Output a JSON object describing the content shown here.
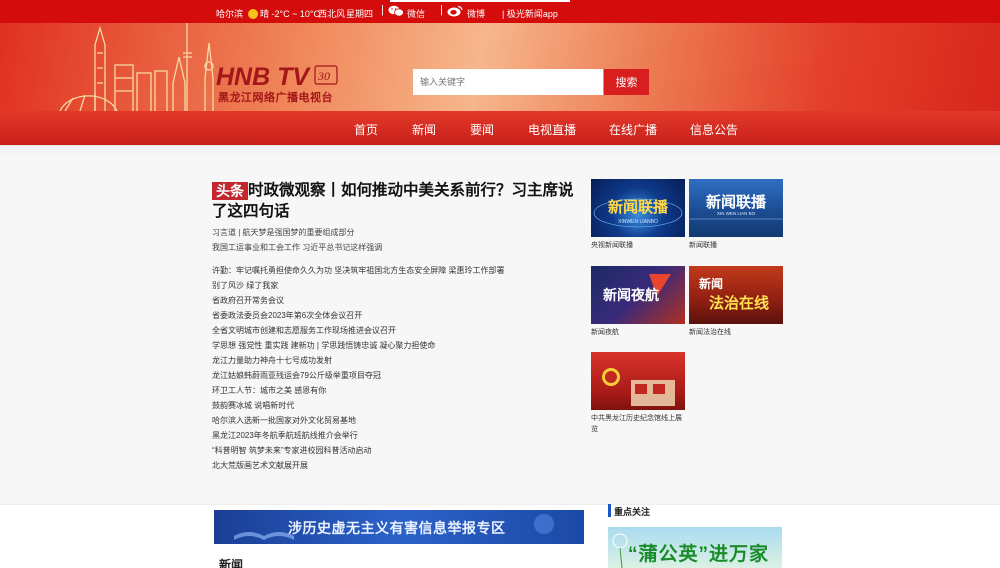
{
  "topbar": {
    "city": "哈尔滨",
    "weather": "晴 -2°C ~ 10°C",
    "wind": "西北风",
    "weekday": "星期四",
    "wechat_label": "微信",
    "weibo_label": "微博",
    "app_label": "| 极光新闻app"
  },
  "header": {
    "logo_main": "HNB TV",
    "logo_sub": "黑龙江网络广播电视台",
    "search_placeholder": "输入关键字",
    "search_button": "搜索"
  },
  "nav": {
    "items": [
      {
        "label": "首页"
      },
      {
        "label": "新闻"
      },
      {
        "label": "要闻"
      },
      {
        "label": "电视直播"
      },
      {
        "label": "在线广播"
      },
      {
        "label": "信息公告"
      }
    ]
  },
  "headline": {
    "tag": "头条",
    "title": "时政微观察丨如何推动中美关系前行？习主席说了这四句话"
  },
  "sub_links": [
    "习言道 | 航天梦是强国梦的重要组成部分",
    "我国工运事业和工会工作 习近平总书记这样强调"
  ],
  "news_list": [
    "许勤：牢记嘱托勇担使命久久为功 坚决筑牢祖国北方生态安全屏障 梁惠玲工作部署",
    "别了风沙 绿了我家",
    "省政府召开常务会议",
    "省委政法委员会2023年第6次全体会议召开",
    "全省文明城市创建和志愿服务工作现场推进会议召开",
    "学思想 强党性 重实践 建新功 | 学思践悟铸忠诚 凝心聚力担使命",
    "龙江力量助力神舟十七号成功发射",
    "龙江姑娘韩蔚雨亚残运会79公斤级举重项目夺冠",
    "环卫工人节：城市之美 感恩有你",
    "鼓韵赛冰城 说唱新时代",
    "哈尔滨入选新一批国家对外文化贸易基地",
    "黑龙江2023年冬航季航班航线推介会举行",
    "“科普明智 筑梦未来”专家进校园科普活动启动",
    "北大荒版画艺术文献展开展"
  ],
  "thumbs": [
    {
      "caption": "央视新闻联播",
      "art": "新闻联播",
      "art_sub": "XINWEN LIANBO"
    },
    {
      "caption": "新闻联播",
      "art": "新闻联播",
      "art_sub": "XIN WEN LIAN BO"
    },
    {
      "caption": "新闻夜航",
      "art": "新闻夜航",
      "art_sub": ""
    },
    {
      "caption": "新闻法治在线",
      "art_top": "新闻",
      "art": "法治在线",
      "art_sub": ""
    },
    {
      "caption": "中共黑龙江历史纪念馆线上展览",
      "art": "",
      "art_sub": ""
    }
  ],
  "banner": {
    "text": "涉历史虚无主义有害信息举报专区"
  },
  "section": {
    "news_title": "新闻",
    "focus_title": "重点关注",
    "focus_text": "“蒲公英”进万家"
  },
  "colors": {
    "primary_red": "#d40c0c",
    "nav_red": "#d22a20",
    "banner_blue": "#1f4fae",
    "accent_blue": "#1a56c8"
  }
}
